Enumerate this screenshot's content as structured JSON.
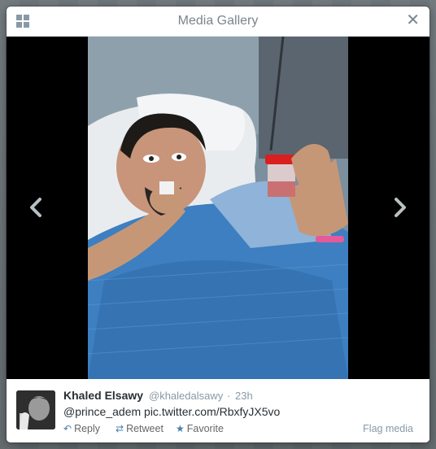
{
  "modal": {
    "title": "Media Gallery",
    "grid_icon": "grid-icon",
    "close_icon": "close-icon",
    "close_glyph": "✕"
  },
  "media": {
    "prev_icon": "chevron-left-icon",
    "next_icon": "chevron-right-icon"
  },
  "tweet": {
    "name": "Khaled Elsawy",
    "handle": "@khaledalsawy",
    "separator": "·",
    "time": "23h",
    "text": "@prince_adem pic.twitter.com/RbxfyJX5vo",
    "actions": {
      "reply": "Reply",
      "retweet": "Retweet",
      "favorite": "Favorite",
      "flag": "Flag media"
    },
    "icons": {
      "reply": "reply-icon",
      "retweet": "retweet-icon",
      "favorite": "star-icon"
    }
  },
  "colors": {
    "accent": "#4b7ea8",
    "muted": "#8899a6",
    "text": "#292f33"
  }
}
